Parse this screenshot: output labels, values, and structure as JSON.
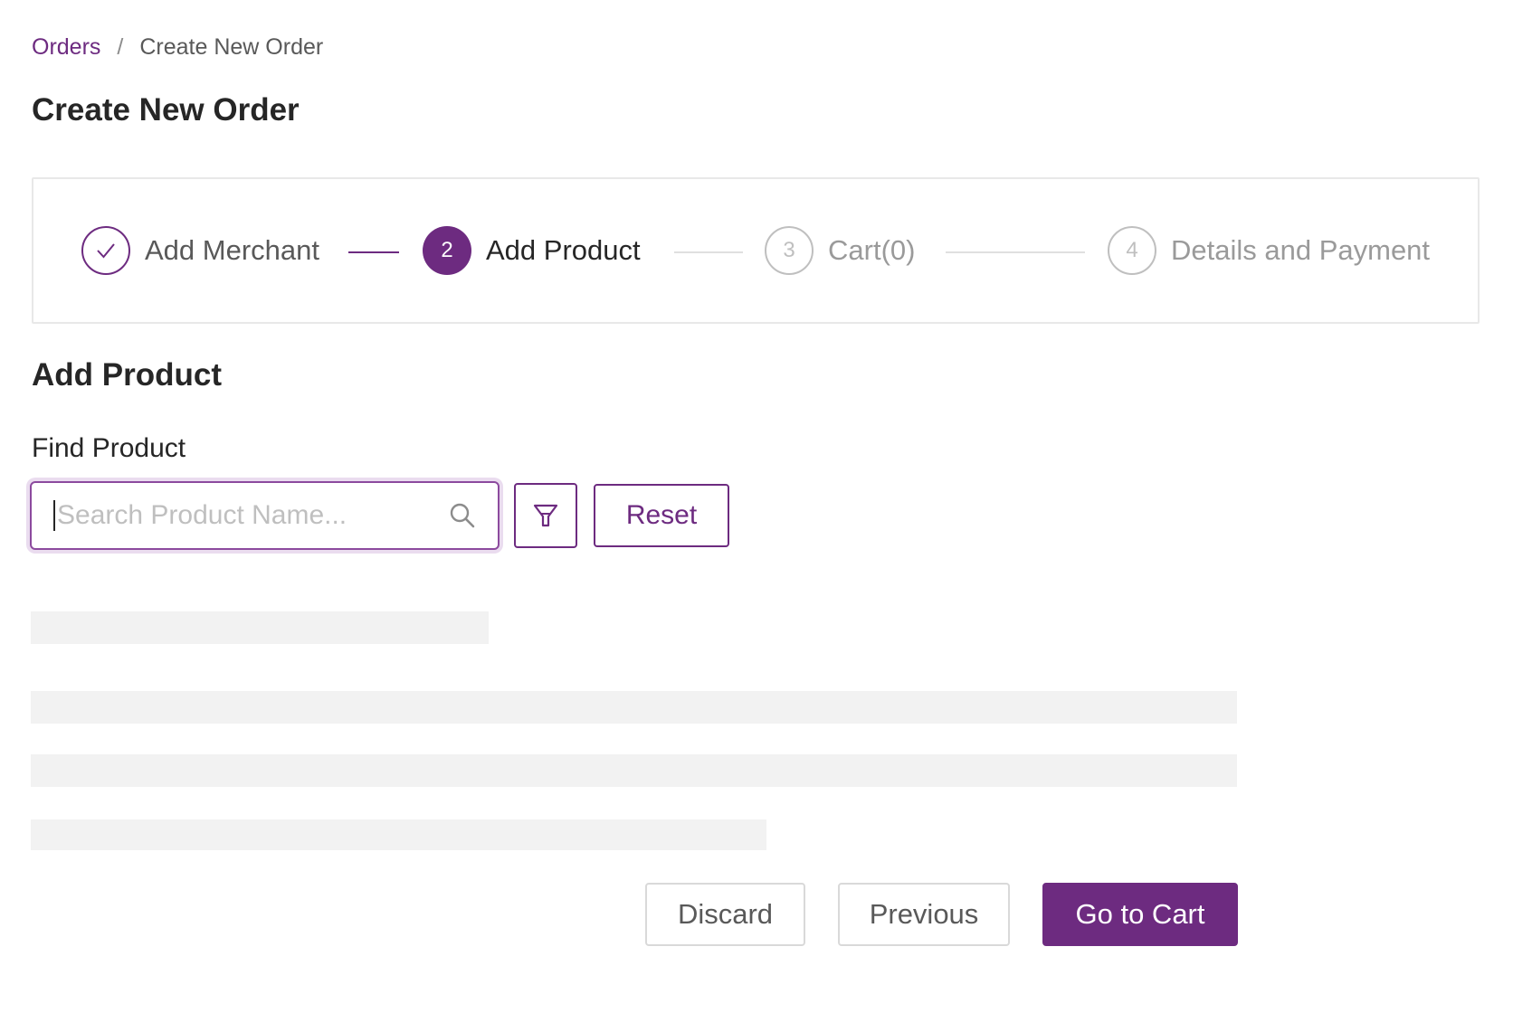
{
  "breadcrumb": {
    "parent": "Orders",
    "separator": "/",
    "current": "Create New Order"
  },
  "page_title": "Create New Order",
  "steps": [
    {
      "number": "",
      "label": "Add Merchant",
      "status": "done",
      "icon": "check-icon"
    },
    {
      "number": "2",
      "label": "Add Product",
      "status": "active"
    },
    {
      "number": "3",
      "label": "Cart(0)",
      "status": "pending"
    },
    {
      "number": "4",
      "label": "Details and Payment",
      "status": "pending"
    }
  ],
  "section_title": "Add Product",
  "find_product": {
    "label": "Find Product",
    "search_value": "",
    "search_placeholder": "Search Product Name...",
    "search_icon": "search-icon",
    "filter_icon": "funnel-icon",
    "reset_label": "Reset"
  },
  "actions": {
    "discard_label": "Discard",
    "previous_label": "Previous",
    "go_to_cart_label": "Go to Cart"
  },
  "colors": {
    "accent": "#6d2b80",
    "skeleton": "#f2f2f2",
    "border": "#e8e8e8"
  }
}
